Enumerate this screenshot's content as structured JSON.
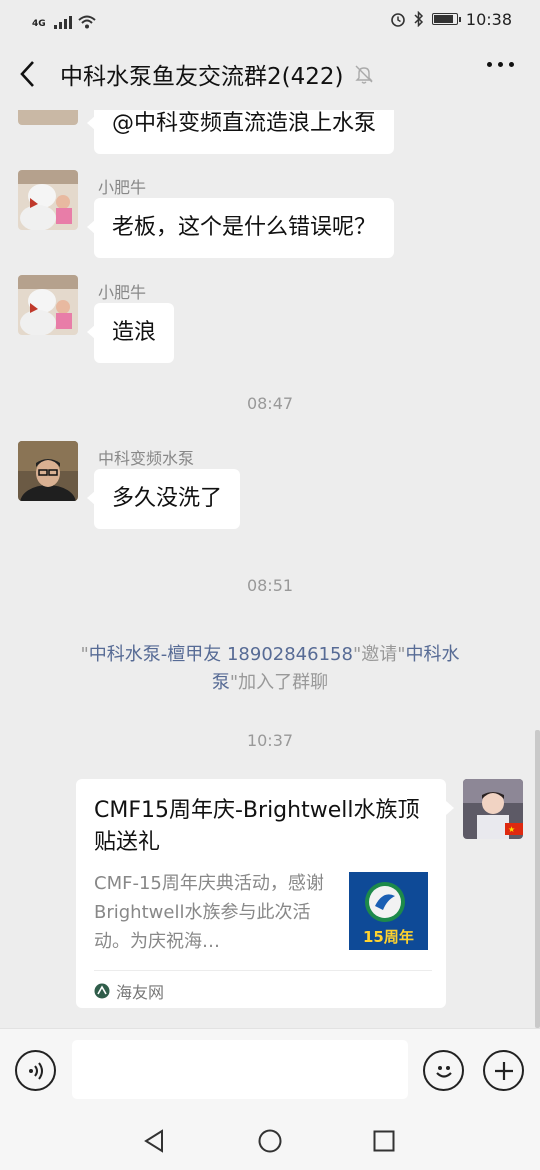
{
  "status_bar": {
    "network": "4G",
    "time": "10:38"
  },
  "header": {
    "title": "中科水泵鱼友交流群2(422)"
  },
  "messages": [
    {
      "text": "@中科变频直流造浪上水泵"
    },
    {
      "sender": "小肥牛",
      "text": "老板，这个是什么错误呢？"
    },
    {
      "sender": "小肥牛",
      "text": "造浪"
    },
    {
      "timestamp": "08:47"
    },
    {
      "sender": "中科变频水泵",
      "text": "多久没洗了"
    },
    {
      "timestamp": "08:51"
    },
    {
      "system": {
        "q1": "\"",
        "inviter": "中科水泵-檀甲友 18902846158",
        "q2": "\"邀请\"",
        "invitee": "中科水",
        "invitee2": "泵",
        "tail": "\"加入了群聊"
      }
    },
    {
      "timestamp": "10:37"
    }
  ],
  "link_card": {
    "title": "CMF15周年庆-Brightwell水族顶贴送礼",
    "description": "CMF-15周年庆典活动，感谢Brightwell水族参与此次活动。为庆祝海…",
    "thumbnail_text": "15周年",
    "source": "海友网"
  }
}
